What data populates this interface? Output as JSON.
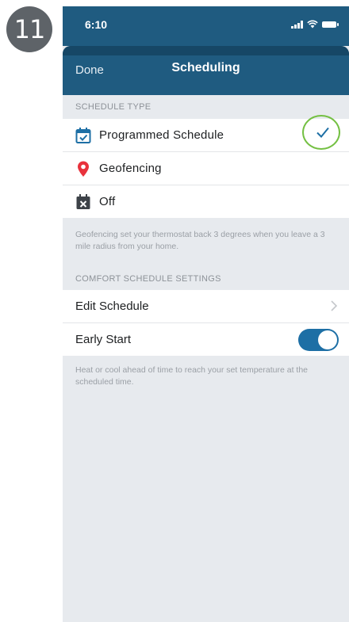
{
  "step": {
    "number": "11"
  },
  "status_bar": {
    "time": "6:10"
  },
  "nav": {
    "done_label": "Done",
    "title": "Scheduling"
  },
  "schedule_type": {
    "header": "SCHEDULE TYPE",
    "options": [
      {
        "label": "Programmed Schedule",
        "icon": "calendar-check-icon",
        "selected": true
      },
      {
        "label": "Geofencing",
        "icon": "location-pin-icon",
        "selected": false
      },
      {
        "label": "Off",
        "icon": "calendar-x-icon",
        "selected": false
      }
    ],
    "footer": "Geofencing set your thermostat back 3 degrees when you  leave a 3 mile radius from your home."
  },
  "comfort": {
    "header": "COMFORT SCHEDULE SETTINGS",
    "edit_schedule_label": "Edit Schedule",
    "early_start_label": "Early Start",
    "early_start_on": true,
    "footer": "Heat or cool ahead of time to reach your set temperature at the scheduled time."
  },
  "colors": {
    "nav_bar": "#1f5b80",
    "accent_blue": "#1d6fa5",
    "highlight_green": "#74c043",
    "pin_red": "#e8323c",
    "badge_gray": "#5e6368"
  }
}
